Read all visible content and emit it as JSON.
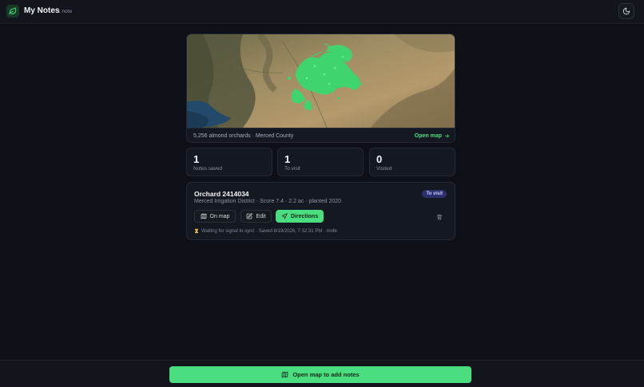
{
  "header": {
    "title": "My Notes",
    "note_count": "1 note",
    "logo_icon": "leaf-icon",
    "theme_icon": "moon-icon"
  },
  "map": {
    "caption": "5,256 almond orchards · Merced County",
    "open_map_label": "Open map",
    "open_map_icon": "arrow-right-icon"
  },
  "stats": [
    {
      "value": "1",
      "label": "Notes saved"
    },
    {
      "value": "1",
      "label": "To visit"
    },
    {
      "value": "0",
      "label": "Visited"
    }
  ],
  "note": {
    "title": "Orchard 2414034",
    "meta": "Merced Irrigation District · Score 7.4 · 2.2 ac · planted 2020",
    "status": "To visit",
    "actions": {
      "on_map": "On map",
      "edit": "Edit",
      "directions": "Directions"
    },
    "sync_status": "Waiting for signal to sync · Saved 8/19/2026, 7:32:31 PM · mofe"
  },
  "bottom": {
    "button_label": "Open map to add notes",
    "button_icon": "map-icon"
  },
  "colors": {
    "accent": "#4ade80",
    "background": "#0d1016",
    "card": "#141821",
    "badge": "#2b2f6b"
  }
}
